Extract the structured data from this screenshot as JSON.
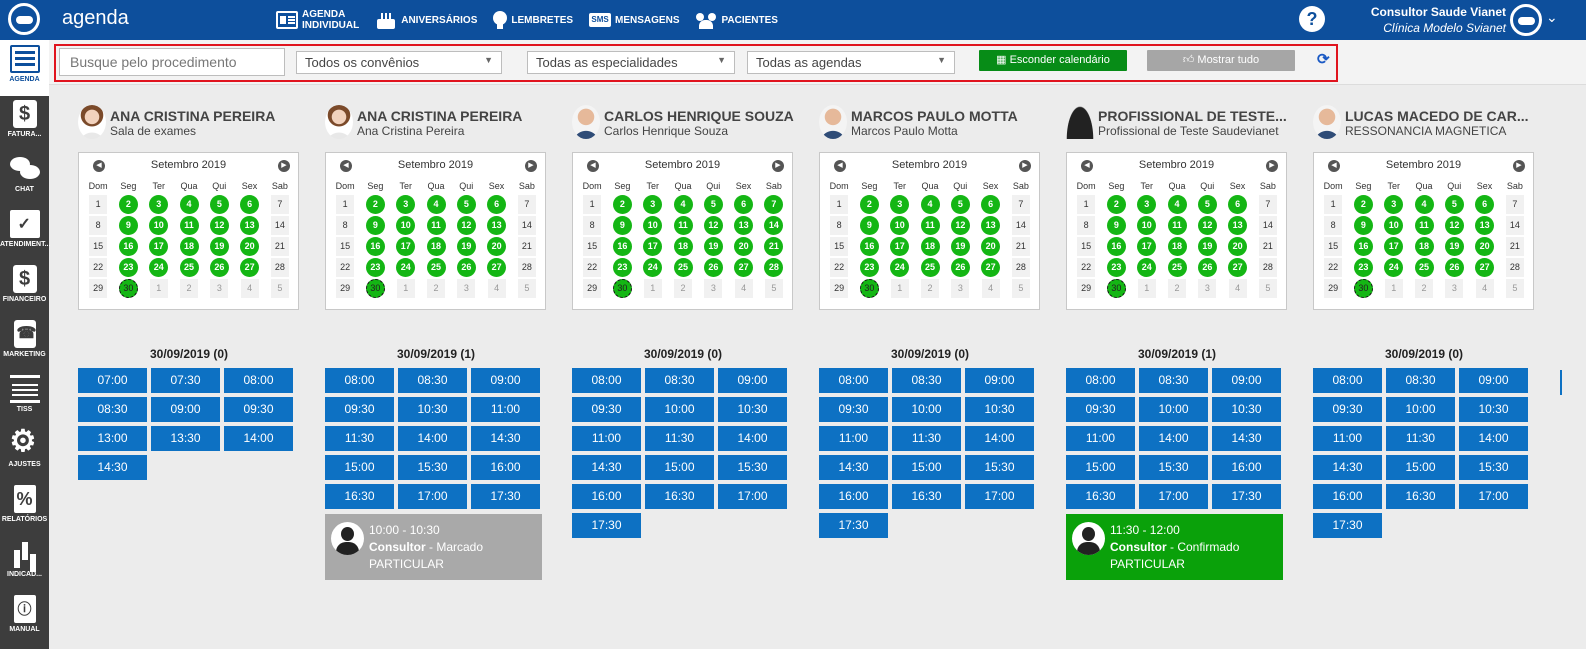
{
  "app": {
    "title": "agenda",
    "nav": [
      {
        "line1": "AGENDA",
        "line2": "INDIVIDUAL",
        "icon": "agenda-individual-icon"
      },
      {
        "line1": "ANIVERSÁRIOS",
        "line2": "",
        "icon": "cake-icon"
      },
      {
        "line1": "LEMBRETES",
        "line2": "",
        "icon": "bulb-icon"
      },
      {
        "line1": "MENSAGENS",
        "line2": "",
        "icon": "sms-icon",
        "badge": "SMS"
      },
      {
        "line1": "PACIENTES",
        "line2": "",
        "icon": "people-icon"
      }
    ],
    "help": "?",
    "user": {
      "name": "Consultor Saude Vianet",
      "clinic": "Clínica Modelo Svianet"
    }
  },
  "sidebar": [
    {
      "label": "AGENDA",
      "icon": "agenda-icon",
      "active": true
    },
    {
      "label": "FATURA...",
      "icon": "dollar-icon"
    },
    {
      "label": "CHAT",
      "icon": "chat-icon"
    },
    {
      "label": "ATENDIMENT...",
      "icon": "folder-check-icon"
    },
    {
      "label": "FINANCEIRO",
      "icon": "dollar-icon"
    },
    {
      "label": "MARKETING",
      "icon": "phone-icon"
    },
    {
      "label": "TISS",
      "icon": "tiss-icon"
    },
    {
      "label": "AJUSTES",
      "icon": "gear-icon"
    },
    {
      "label": "RELATÓRIOS",
      "icon": "percent-icon"
    },
    {
      "label": "INDICAD...",
      "icon": "bar-chart-icon"
    },
    {
      "label": "MANUAL",
      "icon": "manual-icon"
    }
  ],
  "filters": {
    "search_placeholder": "Busque pelo procedimento",
    "convenio": "Todos os convênios",
    "especialidade": "Todas as especialidades",
    "agenda": "Todas as agendas",
    "hide_calendar": "Esconder calendário",
    "show_all": "Mostrar tudo"
  },
  "calendar": {
    "month": "Setembro 2019",
    "dow": [
      "Dom",
      "Seg",
      "Ter",
      "Qua",
      "Qui",
      "Sex",
      "Sab"
    ]
  },
  "columns": [
    {
      "name": "ANA CRISTINA PEREIRA",
      "subtitle": "Sala de exames",
      "avatar": "female",
      "available_days": [
        2,
        3,
        4,
        5,
        6,
        9,
        10,
        11,
        12,
        13,
        16,
        17,
        18,
        19,
        20,
        23,
        24,
        25,
        26,
        27
      ],
      "date_title": "30/09/2019 (0)",
      "slots": [
        "07:00",
        "07:30",
        "08:00",
        "08:30",
        "09:00",
        "09:30",
        "13:00",
        "13:30",
        "14:00",
        "14:30"
      ],
      "appointment": null
    },
    {
      "name": "ANA CRISTINA PEREIRA",
      "subtitle": "Ana Cristina Pereira",
      "avatar": "female",
      "available_days": [
        2,
        3,
        4,
        5,
        6,
        9,
        10,
        11,
        12,
        13,
        16,
        17,
        18,
        19,
        20,
        23,
        24,
        25,
        26,
        27
      ],
      "date_title": "30/09/2019 (1)",
      "slots": [
        "08:00",
        "08:30",
        "09:00",
        "09:30",
        "10:30",
        "11:00",
        "11:30",
        "14:00",
        "14:30",
        "15:00",
        "15:30",
        "16:00",
        "16:30",
        "17:00",
        "17:30"
      ],
      "appointment": {
        "time": "10:00 - 10:30",
        "who": "Consultor",
        "status": " - Marcado",
        "plan": "PARTICULAR",
        "color": "gray"
      }
    },
    {
      "name": "CARLOS HENRIQUE SOUZA",
      "subtitle": "Carlos Henrique Souza",
      "avatar": "male",
      "available_days": [
        2,
        3,
        4,
        5,
        6,
        7,
        9,
        10,
        11,
        12,
        13,
        14,
        16,
        17,
        18,
        19,
        20,
        21,
        23,
        24,
        25,
        26,
        27,
        28
      ],
      "date_title": "30/09/2019 (0)",
      "slots": [
        "08:00",
        "08:30",
        "09:00",
        "09:30",
        "10:00",
        "10:30",
        "11:00",
        "11:30",
        "14:00",
        "14:30",
        "15:00",
        "15:30",
        "16:00",
        "16:30",
        "17:00",
        "17:30"
      ],
      "appointment": null
    },
    {
      "name": "MARCOS PAULO MOTTA",
      "subtitle": "Marcos Paulo Motta",
      "avatar": "male",
      "available_days": [
        2,
        3,
        4,
        5,
        6,
        9,
        10,
        11,
        12,
        13,
        16,
        17,
        18,
        19,
        20,
        23,
        24,
        25,
        26,
        27
      ],
      "date_title": "30/09/2019 (0)",
      "slots": [
        "08:00",
        "08:30",
        "09:00",
        "09:30",
        "10:00",
        "10:30",
        "11:00",
        "11:30",
        "14:00",
        "14:30",
        "15:00",
        "15:30",
        "16:00",
        "16:30",
        "17:00",
        "17:30"
      ],
      "appointment": null
    },
    {
      "name": "PROFISSIONAL DE TESTE...",
      "subtitle": "Profissional de Teste Saudevianet",
      "avatar": "silhouette",
      "available_days": [
        2,
        3,
        4,
        5,
        6,
        9,
        10,
        11,
        12,
        13,
        16,
        17,
        18,
        19,
        20,
        23,
        24,
        25,
        26,
        27
      ],
      "date_title": "30/09/2019 (1)",
      "slots": [
        "08:00",
        "08:30",
        "09:00",
        "09:30",
        "10:00",
        "10:30",
        "11:00",
        "14:00",
        "14:30",
        "15:00",
        "15:30",
        "16:00",
        "16:30",
        "17:00",
        "17:30"
      ],
      "appointment": {
        "time": "11:30 - 12:00",
        "who": "Consultor",
        "status": " - Confirmado",
        "plan": "PARTICULAR",
        "color": "green"
      }
    },
    {
      "name": "LUCAS MACEDO DE CAR...",
      "subtitle": "RESSONANCIA MAGNETICA",
      "avatar": "male",
      "available_days": [
        2,
        3,
        4,
        5,
        6,
        9,
        10,
        11,
        12,
        13,
        16,
        17,
        18,
        19,
        20,
        23,
        24,
        25,
        26,
        27
      ],
      "date_title": "30/09/2019 (0)",
      "slots": [
        "08:00",
        "08:30",
        "09:00",
        "09:30",
        "10:00",
        "10:30",
        "11:00",
        "11:30",
        "14:00",
        "14:30",
        "15:00",
        "15:30",
        "16:00",
        "16:30",
        "17:00",
        "17:30"
      ],
      "appointment": null
    }
  ],
  "colors": {
    "topbar": "#0d4f9c",
    "slot": "#0d71c3",
    "available": "#14b614",
    "confirmed": "#0aa10a",
    "marked": "#a9a9a9"
  }
}
